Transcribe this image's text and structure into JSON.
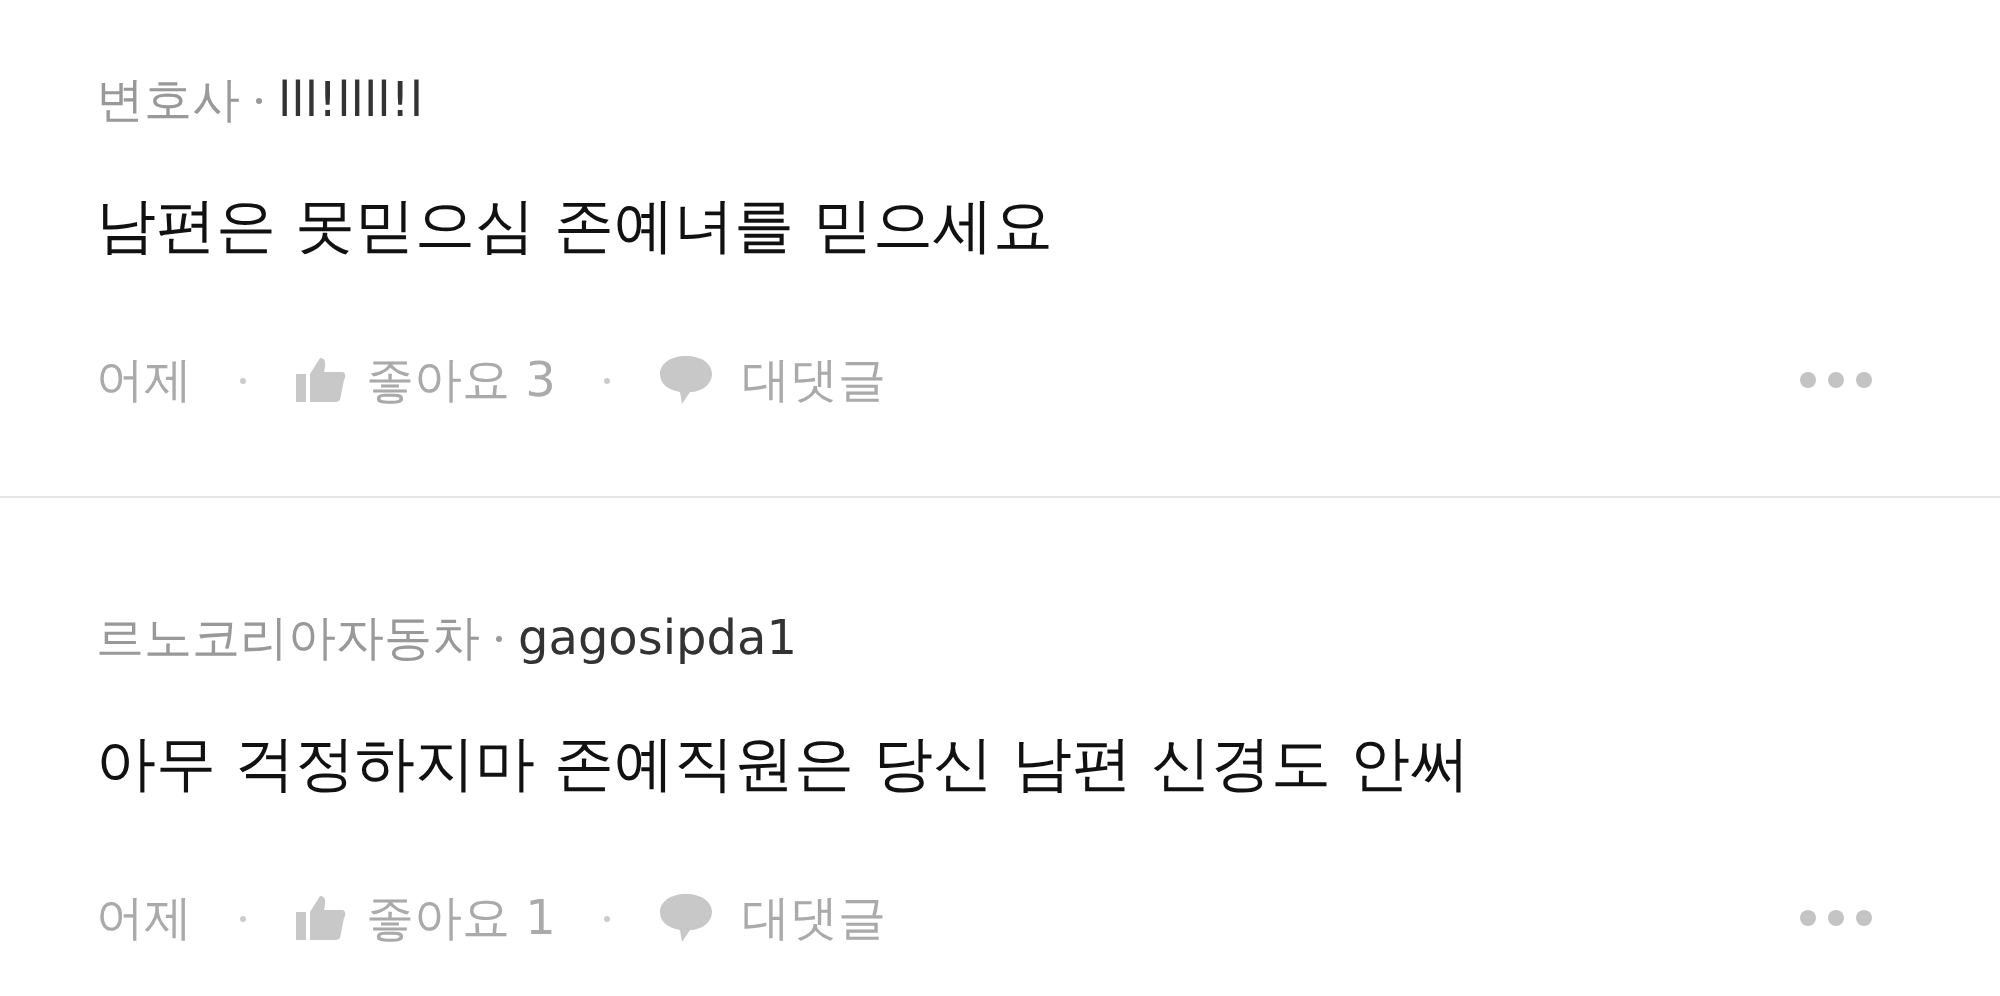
{
  "comments": [
    {
      "affiliation": "변호사",
      "author": "lll!llll!l",
      "body": "남편은 못믿으심 존예녀를 믿으세요",
      "time": "어제",
      "likes": "좋아요 3",
      "reply": "대댓글"
    },
    {
      "affiliation": "르노코리아자동차",
      "author": "gagosipda1",
      "body": "아무 걱정하지마 존예직원은 당신 남편 신경도 안써",
      "time": "어제",
      "likes": "좋아요 1",
      "reply": "대댓글"
    }
  ]
}
